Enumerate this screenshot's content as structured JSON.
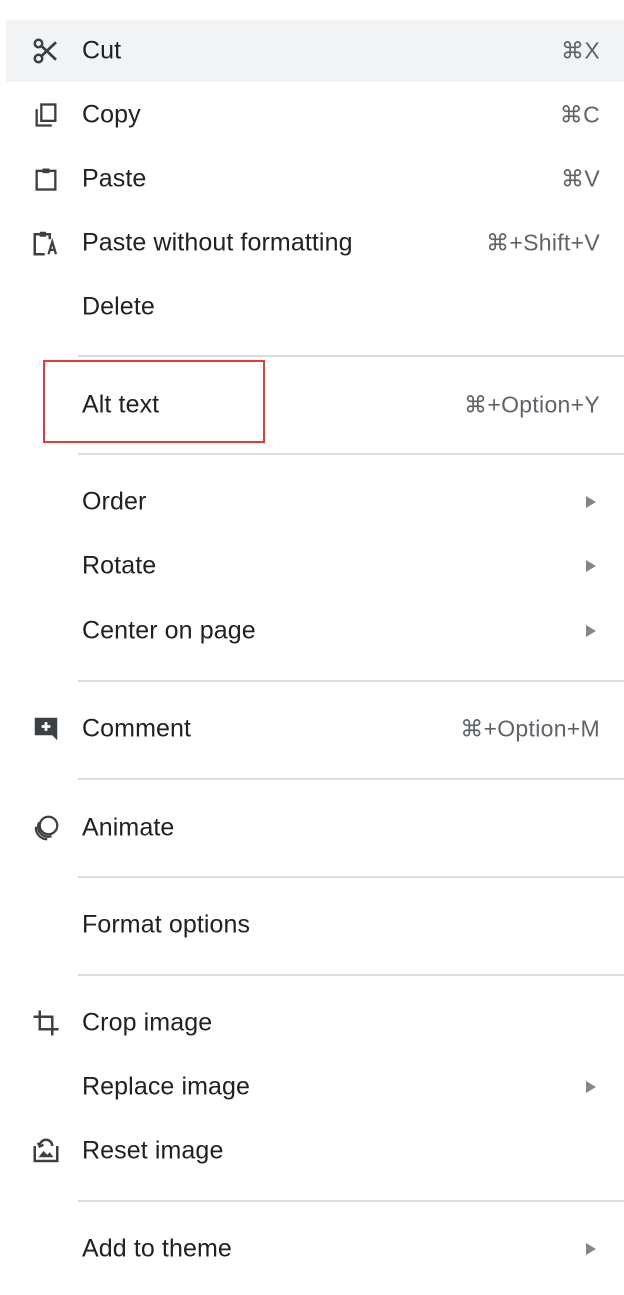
{
  "menu": {
    "cut": {
      "label": "Cut",
      "shortcut": "⌘X",
      "icon": "scissors-icon"
    },
    "copy": {
      "label": "Copy",
      "shortcut": "⌘C",
      "icon": "copy-icon"
    },
    "paste": {
      "label": "Paste",
      "shortcut": "⌘V",
      "icon": "clipboard-icon"
    },
    "paste_plain": {
      "label": "Paste without formatting",
      "shortcut": "⌘+Shift+V",
      "icon": "paste-text-icon"
    },
    "delete": {
      "label": "Delete"
    },
    "alt_text": {
      "label": "Alt text",
      "shortcut": "⌘+Option+Y"
    },
    "order": {
      "label": "Order",
      "has_submenu": true
    },
    "rotate": {
      "label": "Rotate",
      "has_submenu": true
    },
    "center": {
      "label": "Center on page",
      "has_submenu": true
    },
    "comment": {
      "label": "Comment",
      "shortcut": "⌘+Option+M",
      "icon": "add-comment-icon"
    },
    "animate": {
      "label": "Animate",
      "icon": "animate-icon"
    },
    "format_options": {
      "label": "Format options"
    },
    "crop": {
      "label": "Crop image",
      "icon": "crop-icon"
    },
    "replace": {
      "label": "Replace image",
      "has_submenu": true
    },
    "reset": {
      "label": "Reset image",
      "icon": "reset-image-icon"
    },
    "add_theme": {
      "label": "Add to theme",
      "has_submenu": true
    }
  },
  "colors": {
    "hover_background": "#f1f3f4",
    "separator": "#dadce0",
    "highlight_box": "#e53935",
    "shortcut_text": "#5f6368"
  }
}
